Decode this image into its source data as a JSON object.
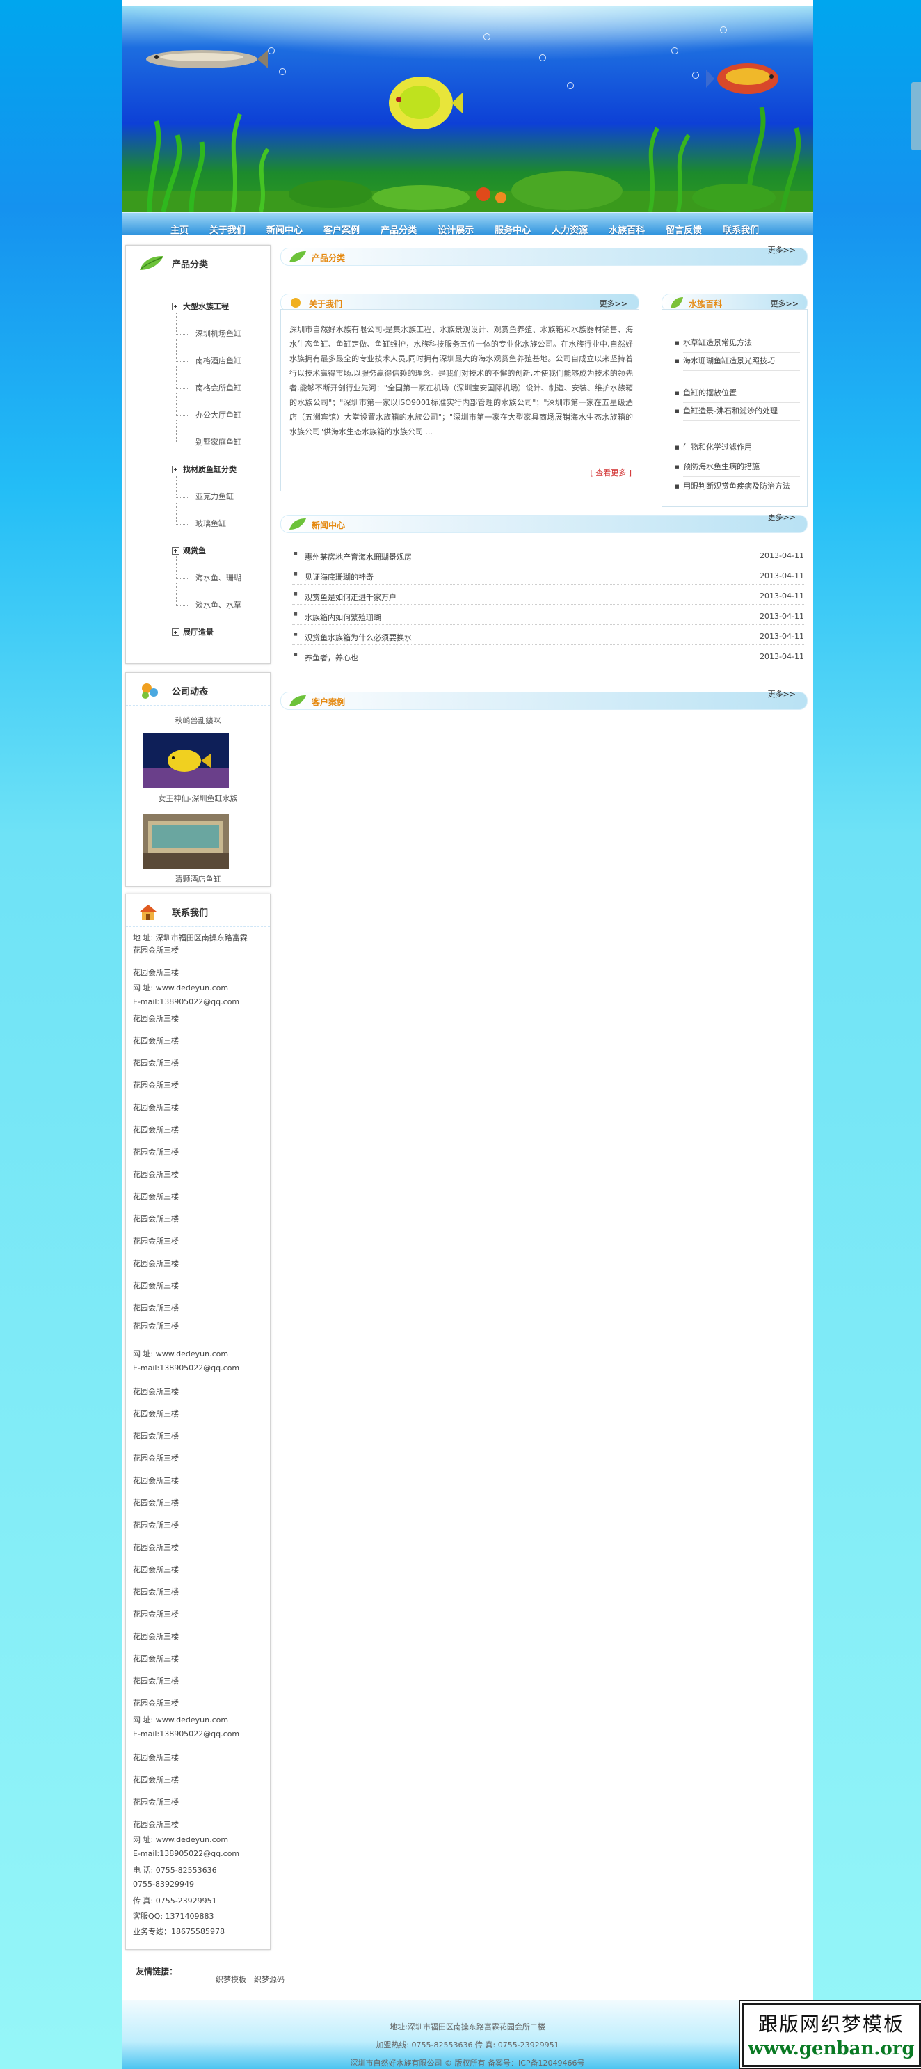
{
  "nav": [
    "主页",
    "关于我们",
    "新闻中心",
    "客户案例",
    "产品分类",
    "设计展示",
    "服务中心",
    "人力资源",
    "水族百科",
    "留言反馈",
    "联系我们"
  ],
  "sidebar": {
    "products": {
      "title": "产品分类",
      "items": [
        {
          "label": "大型水族工程",
          "level": 1
        },
        {
          "label": "深圳机场鱼缸",
          "level": 2
        },
        {
          "label": "南格酒店鱼缸",
          "level": 2
        },
        {
          "label": "南格会所鱼缸",
          "level": 2
        },
        {
          "label": "办公大厅鱼缸",
          "level": 2
        },
        {
          "label": "别墅家庭鱼缸",
          "level": 2
        },
        {
          "label": "找材质鱼缸分类",
          "level": 1
        },
        {
          "label": "亚克力鱼缸",
          "level": 2
        },
        {
          "label": "玻璃鱼缸",
          "level": 2
        },
        {
          "label": "观赏鱼",
          "level": 1
        },
        {
          "label": "海水鱼、珊瑚",
          "level": 2
        },
        {
          "label": "淡水鱼、水草",
          "level": 2
        },
        {
          "label": "展厅造景",
          "level": 1
        }
      ]
    },
    "company_news": {
      "title": "公司动态",
      "top_caption": "秋崎兽乱鑛咪",
      "cases": [
        {
          "caption": "女王神仙-深圳鱼缸水族"
        },
        {
          "caption": "清颢酒店鱼缸"
        }
      ]
    },
    "contact": {
      "title": "联系我们",
      "address_label": "地 址: 深圳市福田区南操东路富霖",
      "floor": "花园会所三楼",
      "web": "网 址: www.dedeyun.com",
      "email": "E-mail:138905022@qq.com",
      "phone": "电 话: 0755-82553636",
      "phone2": "0755-83929949",
      "fax": "传 真: 0755-23929951",
      "qq": "客服QQ: 1371409883",
      "hotline": "业务专线：18675585978"
    }
  },
  "main": {
    "more": "更多>>",
    "product_section": "产品分类",
    "about": {
      "title": "关于我们",
      "text": "深圳市自然好水族有限公司-是集水族工程、水族景观设计、观赏鱼养殖、水族箱和水族器材销售、海水生态鱼缸、鱼缸定做、鱼缸维护，水族科技服务五位一体的专业化水族公司。在水族行业中,自然好水族拥有最多最全的专业技术人员,同时拥有深圳最大的海水观赏鱼养殖基地。公司自成立以来坚持着行以技术赢得市场,以服务赢得信赖的理念。是我们对技术的不懈的创新,才使我们能够成为技术的领先者,能够不断开创行业先河：\"全国第一家在机场（深圳宝安国际机场）设计、制造、安装、维护水族箱的水族公司\"；\"深圳市第一家以ISO9001标准实行内部管理的水族公司\"；\"深圳市第一家在五星级酒店（五洲宾馆）大堂设置水族箱的水族公司\"；\"深圳市第一家在大型家具商场展销海水生态水族箱的水族公司\"供海水生态水族箱的水族公司 ...",
      "more_link": "[ 查看更多 ]"
    },
    "encyclopedia": {
      "title": "水族百科",
      "items": [
        "水草缸造景常见方法",
        "海水珊瑚鱼缸造景光照技巧",
        "鱼缸的摆放位置",
        "鱼缸造景-沸石和滤沙的处理",
        "生物和化学过滤作用",
        "预防海水鱼生病的措施",
        "用眼判断观赏鱼疾病及防治方法"
      ]
    },
    "news": {
      "title": "新闻中心",
      "items": [
        {
          "title": "惠州某房地产育海水珊瑚景观房",
          "date": "2013-04-11"
        },
        {
          "title": "见证海底珊瑚的神奇",
          "date": "2013-04-11"
        },
        {
          "title": "观赏鱼是如何走进千家万户",
          "date": "2013-04-11"
        },
        {
          "title": "水族箱内如何繁殖珊瑚",
          "date": "2013-04-11"
        },
        {
          "title": "观赏鱼水族箱为什么必须要换水",
          "date": "2013-04-11"
        },
        {
          "title": "养鱼者，养心也",
          "date": "2013-04-11"
        }
      ]
    },
    "cases": {
      "title": "客户案例"
    }
  },
  "footer": {
    "links_label": "友情链接：",
    "links": [
      "织梦模板",
      "织梦源码"
    ],
    "address": "地址:深圳市福田区南操东路富霖花园会所二楼",
    "contact": "加盟热线: 0755-82553636 传 真: 0755-23929951",
    "copyright": "深圳市自然好水族有限公司 © 版权所有 备案号：ICP备12049466号"
  },
  "watermark": {
    "line1": "跟版网织梦模板",
    "line2": "www.genban.org"
  },
  "colors": {
    "page_bg_top": "#00a6ee",
    "page_bg_bottom": "#96f6f8",
    "section_title": "#e58a12",
    "link_red": "#d02a2a"
  }
}
